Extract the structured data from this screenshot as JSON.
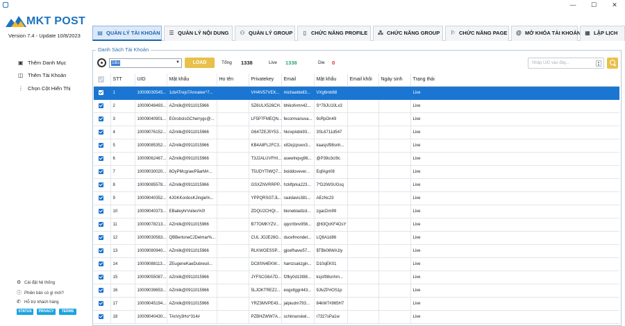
{
  "app": {
    "logo_text": "MKT POST",
    "version_text": "Version  7.4  - Update  10/8/2023"
  },
  "window_controls": {
    "minimize": "—",
    "maximize": "☐",
    "close": "✕"
  },
  "tabs": [
    {
      "label": "QUẢN LÝ TÀI KHOẢN",
      "icon": "id-card-icon",
      "active": true
    },
    {
      "label": "QUẢN LÝ NỘI DUNG",
      "icon": "list-icon",
      "active": false
    },
    {
      "label": "QUẢN LÝ GROUP",
      "icon": "group-icon",
      "active": false
    },
    {
      "label": "CHỨC NĂNG PROFILE",
      "icon": "document-icon",
      "active": false
    },
    {
      "label": "CHỨC NĂNG GROUP",
      "icon": "network-icon",
      "active": false
    },
    {
      "label": "CHỨC NĂNG PAGE",
      "icon": "flag-icon",
      "active": false
    },
    {
      "label": "MỞ KHÓA TÀI KHOẢN",
      "icon": "at-icon",
      "active": false
    },
    {
      "label": "LẬP LỊCH",
      "icon": "calendar-icon",
      "active": false
    }
  ],
  "sidebar": {
    "items": [
      {
        "label": "Thêm Danh Mục",
        "icon": "folder-add-icon"
      },
      {
        "label": "Thêm Tài Khoản",
        "icon": "user-add-icon"
      },
      {
        "label": "Chọn Cột Hiển Thị",
        "icon": "columns-icon"
      }
    ],
    "footer": [
      {
        "label": "Cài đặt hệ thống",
        "icon": "gear-icon"
      },
      {
        "label": "Phiên bản có gì mới?",
        "icon": "info-icon"
      },
      {
        "label": "Hỗ trợ khách hàng",
        "icon": "support-icon"
      }
    ],
    "badges": [
      "STATUS",
      "PRIVACY",
      "TERMS"
    ]
  },
  "panel": {
    "title": "Danh Sách Tài Khoản",
    "category_value": "1&s",
    "load_label": "LOAD",
    "total_label": "Tổng",
    "total_value": "1338",
    "live_label": "Live",
    "live_value": "1338",
    "die_label": "Die",
    "die_value": "0",
    "search_placeholder": "Nhập UID vào đây...",
    "colors": {
      "live": "#2aa876",
      "die": "#e02424",
      "accent": "#1a76d2",
      "button": "#e8c04a"
    }
  },
  "table": {
    "columns": [
      "",
      "STT",
      "UID",
      "Mật khẩu",
      "Ho tên",
      "Privatekey",
      "Email",
      "Mật khẩu",
      "Email khôi",
      "Ngày sinh",
      "Trạng thái"
    ],
    "rows": [
      [
        "1",
        "10009030545...",
        "1cbATrejoTAnnalee^7...",
        "",
        "VH4IV57VEK...",
        "michaeldell3...",
        "VXg6mb68",
        "",
        "",
        "Live"
      ],
      [
        "2",
        "10009048493...",
        "AZmilk@0911015966",
        "",
        "SZ6ULX526CH...",
        "bhikofvmn42...",
        "S^78JU10Lx3",
        "",
        "",
        "Live"
      ],
      [
        "3",
        "10009040901...",
        "EGrobsIsGCherrygc@...",
        "",
        "LF5P7FMEQN...",
        "fecornvanuva...",
        "9cRpOn49",
        "",
        "",
        "Live"
      ],
      [
        "4",
        "10009076152...",
        "AZmilk@0911015966",
        "",
        "G647ZEJ5Y53...",
        "hknxplobk93...",
        "3SL6711d547",
        "",
        "",
        "Live"
      ],
      [
        "5",
        "10009085352...",
        "AZmilk@0911015966",
        "",
        "KB4A8FL2FC3...",
        "x82ejzpswx3...",
        "kaasjsf98snh...",
        "",
        "",
        "Live"
      ],
      [
        "6",
        "10009062467...",
        "AZmilk@0911015966",
        "",
        "T3J2ALUVFHI...",
        "asewlnqvg96...",
        "@P39o3cI9c",
        "",
        "",
        "Live"
      ],
      [
        "7",
        "10009030020...",
        "8OyPMcgrawPåarM#...",
        "",
        "T5UDYTIWQ7...",
        "boiddovever...",
        "EqfAgn08",
        "",
        "",
        "Live"
      ],
      [
        "8",
        "10009085578...",
        "AZmilk@0911015966",
        "",
        "GSXZNVRRPP...",
        "hzklfprka223...",
        "7*D2IW3UGsq",
        "",
        "",
        "Live"
      ],
      [
        "9",
        "10009040352...",
        "4JGKKordosKJingie%...",
        "",
        "YPPQRSGTJL...",
        "rauldavis381...",
        "AEzNc23",
        "",
        "",
        "Live"
      ],
      [
        "10",
        "10009040373...",
        "EBaileyhrVoiles%0!",
        "",
        "ZDQU2CHQI...",
        "bionebladizd...",
        "zgacDm99",
        "",
        "",
        "Live"
      ],
      [
        "11",
        "10009078213...",
        "AZmilk@0911015966",
        "",
        "B77OMKYZV...",
        "qqcrrlbnv956...",
        "@63QcKF4OsY",
        "",
        "",
        "Live"
      ],
      [
        "12",
        "10009030563...",
        "QBBertoneCJDelmar%...",
        "",
        "CUL JOJE26G...",
        "ducefmondet...",
        "LQ8A1d86",
        "",
        "",
        "Live"
      ],
      [
        "13",
        "10009080940...",
        "AZmilk@0911015966",
        "",
        "RLKWOESSP...",
        "gjoefhavw57...",
        "$TBk06WA1ly",
        "",
        "",
        "Live"
      ],
      [
        "14",
        "10009088113...",
        "ZEugeneKaeDubreuil...",
        "",
        "DC8SN4EKW...",
        "hamzsakzgin...",
        "D10qEK01",
        "",
        "",
        "Live"
      ],
      [
        "15",
        "10009055087...",
        "AZmilk@0911015966",
        "",
        "JYFSCG6A7D...",
        "f2fky0d13t98...",
        "ksjsf98snhm...",
        "",
        "",
        "Live"
      ],
      [
        "16",
        "10009039653...",
        "AZmilk@0911015966",
        "",
        "5LJOKTREZJ...",
        "eogxltggr443...",
        "9JlvZP#OS1p",
        "",
        "",
        "Live"
      ],
      [
        "17",
        "10009045194...",
        "AZmilk@0911015966",
        "",
        "YRZ3MVPE43...",
        "jalpiudm793...",
        "84kW7#965H7",
        "",
        "",
        "Live"
      ],
      [
        "18",
        "10009040430...",
        "TAnVy3Ho^314#",
        "",
        "PZBHZWW7A...",
        "schimanskel...",
        "r7327sPa1w",
        "",
        "",
        "Live"
      ]
    ]
  }
}
